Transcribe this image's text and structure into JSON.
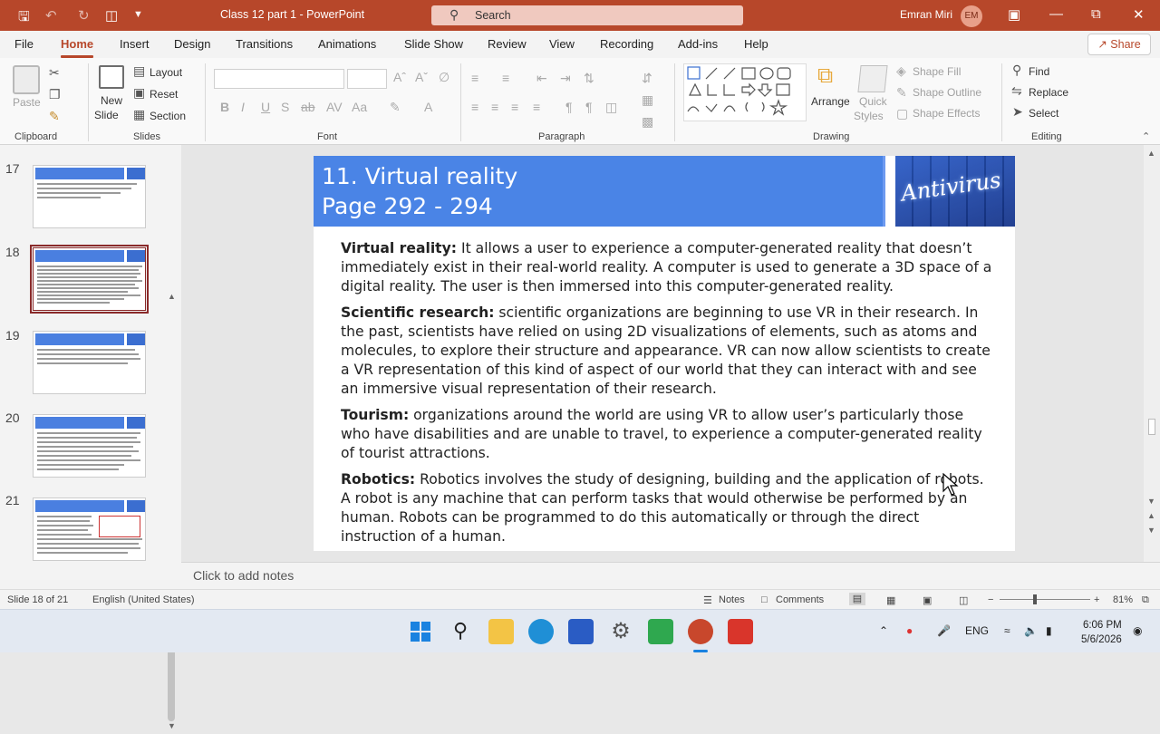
{
  "titlebar": {
    "doc_title": "Class 12 part 1  -  PowerPoint",
    "search_placeholder": "Search",
    "user_name": "Emran Miri",
    "user_initials": "EM"
  },
  "menu": {
    "tabs": [
      "File",
      "Home",
      "Insert",
      "Design",
      "Transitions",
      "Animations",
      "Slide Show",
      "Review",
      "View",
      "Recording",
      "Add-ins",
      "Help"
    ],
    "active": "Home",
    "share": "Share"
  },
  "ribbon": {
    "clipboard": {
      "paste": "Paste",
      "label": "Clipboard"
    },
    "slides": {
      "new_slide_1": "New",
      "new_slide_2": "Slide",
      "layout": "Layout",
      "reset": "Reset",
      "section": "Section",
      "label": "Slides"
    },
    "font": {
      "label": "Font"
    },
    "paragraph": {
      "label": "Paragraph"
    },
    "drawing": {
      "arrange": "Arrange",
      "quick_styles_1": "Quick",
      "quick_styles_2": "Styles",
      "shape_fill": "Shape Fill",
      "shape_outline": "Shape Outline",
      "shape_effects": "Shape Effects",
      "label": "Drawing"
    },
    "editing": {
      "find": "Find",
      "replace": "Replace",
      "select": "Select",
      "label": "Editing"
    }
  },
  "thumbnails": [
    {
      "num": "17",
      "selected": false
    },
    {
      "num": "18",
      "selected": true
    },
    {
      "num": "19",
      "selected": false
    },
    {
      "num": "20",
      "selected": false
    },
    {
      "num": "21",
      "selected": false
    }
  ],
  "slide": {
    "title_line1": "11. Virtual reality",
    "title_line2": "Page 292 - 294",
    "image_text": "Antivirus",
    "paragraphs": [
      {
        "term": "Virtual reality:",
        "text": " It allows a user to experience a computer-generated reality that doesn’t immediately exist in their real-world reality. A computer is used to generate a 3D space of a digital reality. The user is then immersed into this computer-generated reality."
      },
      {
        "term": "Scientific research:",
        "text": " scientific organizations are beginning to use VR in their research. In the past, scientists have relied on using 2D visualizations of elements, such as atoms and molecules, to explore their structure and appearance. VR can now allow scientists to create a VR representation of this kind of aspect of our world that they can interact with and see an immersive visual representation of their research."
      },
      {
        "term": "Tourism:",
        "text": " organizations around the world are using VR to allow user’s particularly those who have disabilities and are unable to travel, to experience a computer-generated reality of tourist attractions."
      },
      {
        "term": "Robotics:",
        "text": " Robotics involves the study of designing, building and the application of robots. A robot is any machine that can perform tasks that would otherwise be performed by an human. Robots can be programmed to do this automatically or through the direct instruction of a human."
      }
    ]
  },
  "notes_placeholder": "Click to add notes",
  "status": {
    "slide_info": "Slide 18 of 21",
    "language": "English (United States)",
    "notes": "Notes",
    "comments": "Comments",
    "zoom": "81%"
  },
  "taskbar": {
    "language": "ENG",
    "time": "6:06 PM",
    "date": "5/6/2026"
  },
  "colors": {
    "accent": "#b7472a",
    "slide_header": "#4a84e6"
  }
}
